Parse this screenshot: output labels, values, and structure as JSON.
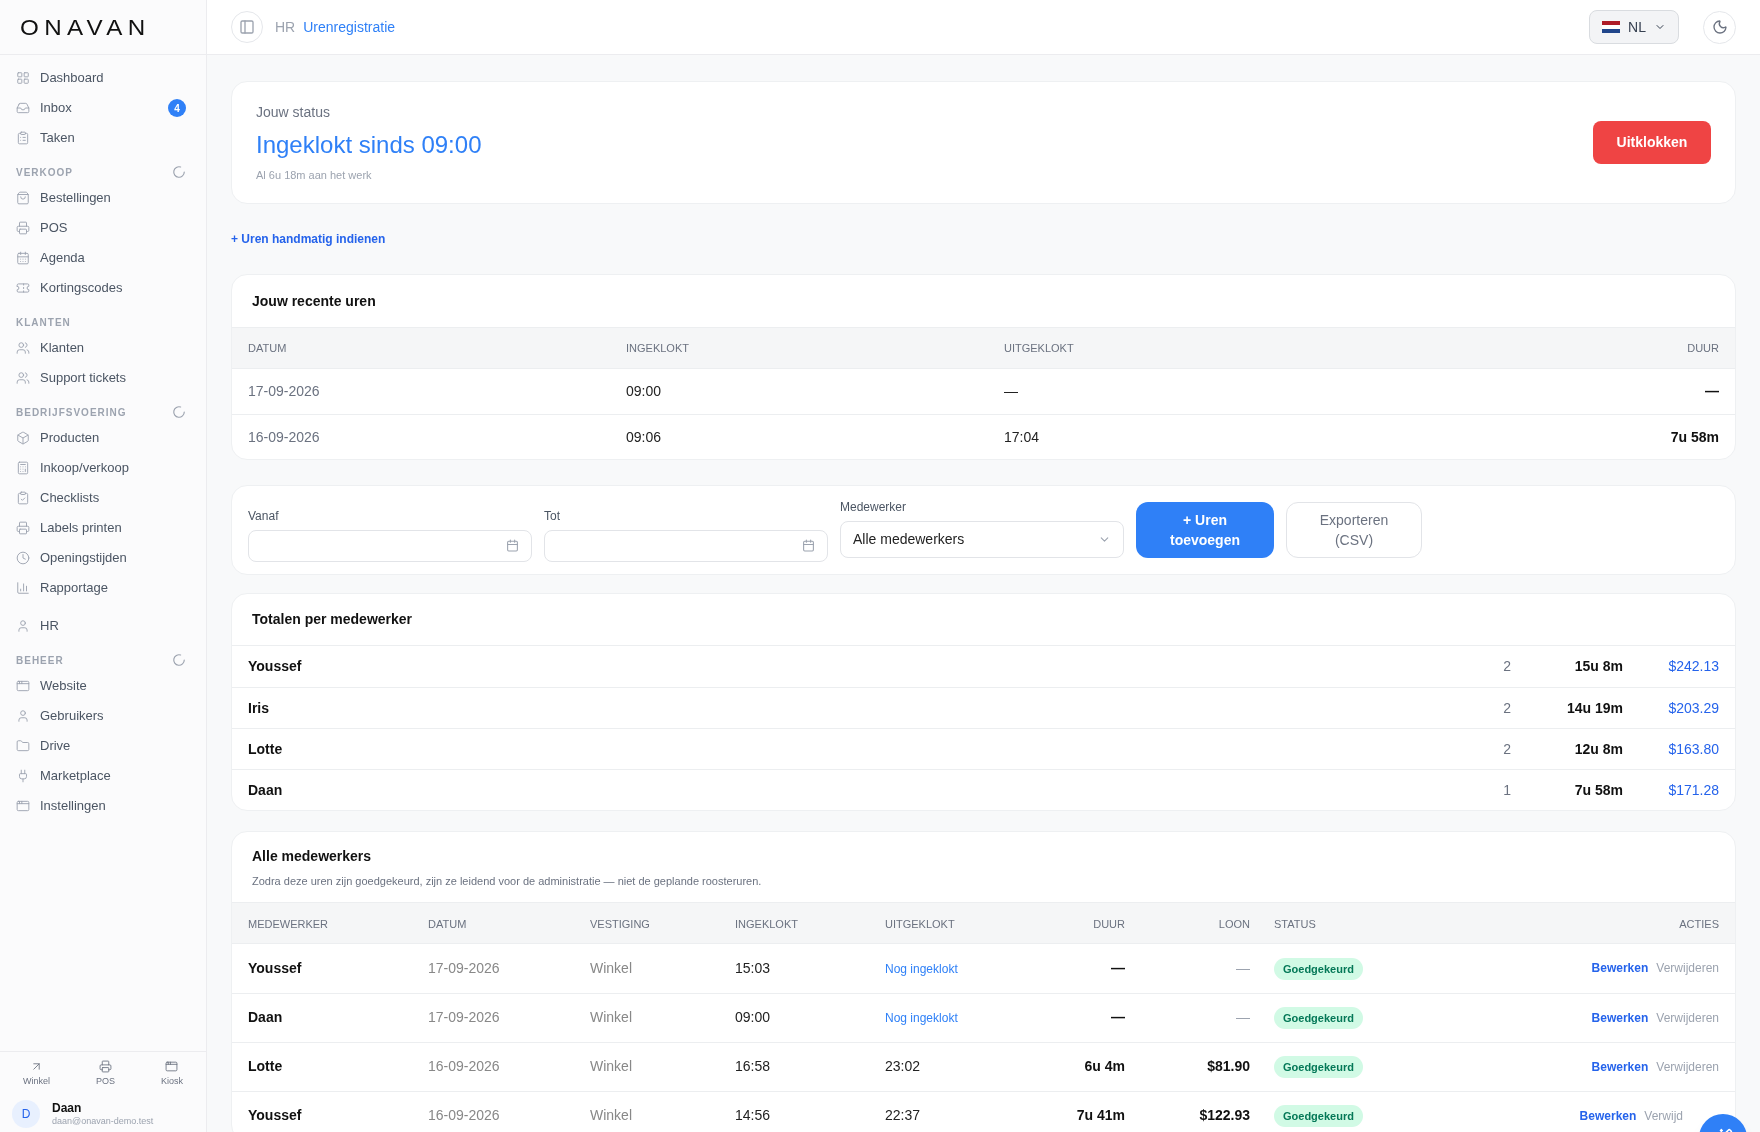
{
  "sidebar": {
    "logo": "ONAVAN",
    "sections": [
      {
        "items": [
          {
            "label": "Dashboard"
          },
          {
            "label": "Inbox",
            "badge": "4"
          },
          {
            "label": "Taken"
          }
        ]
      },
      {
        "title": "VERKOOP",
        "loading": true,
        "items": [
          {
            "label": "Bestellingen"
          },
          {
            "label": "POS"
          },
          {
            "label": "Agenda"
          },
          {
            "label": "Kortingscodes"
          }
        ]
      },
      {
        "title": "KLANTEN",
        "loading": false,
        "items": [
          {
            "label": "Klanten"
          },
          {
            "label": "Support tickets"
          }
        ]
      },
      {
        "title": "BEDRIJFSVOERING",
        "loading": true,
        "items": [
          {
            "label": "Producten"
          },
          {
            "label": "Inkoop/verkoop"
          },
          {
            "label": "Checklists"
          },
          {
            "label": "Labels printen"
          },
          {
            "label": "Openingstijden"
          },
          {
            "label": "Rapportage"
          }
        ]
      },
      {
        "items": [
          {
            "label": "HR"
          }
        ]
      },
      {
        "title": "BEHEER",
        "loading": true,
        "items": [
          {
            "label": "Website"
          },
          {
            "label": "Gebruikers"
          },
          {
            "label": "Drive"
          },
          {
            "label": "Marketplace"
          },
          {
            "label": "Instellingen"
          }
        ]
      }
    ],
    "quick_links": [
      "Winkel",
      "POS",
      "Kiosk"
    ],
    "user": {
      "initial": "D",
      "name": "Daan",
      "email": "daan@onavan-demo.test"
    }
  },
  "header": {
    "breadcrumb": [
      "HR",
      "Urenregistratie"
    ],
    "language": "NL"
  },
  "status": {
    "label": "Jouw status",
    "title": "Ingeklokt sinds 09:00",
    "subtitle": "Al 6u 18m aan het werk",
    "button": "Uitklokken"
  },
  "manual_link": "+ Uren handmatig indienen",
  "recent": {
    "title": "Jouw recente uren",
    "columns": [
      "DATUM",
      "INGEKLOKT",
      "UITGEKLOKT",
      "DUUR"
    ],
    "rows": [
      [
        "17-09-2026",
        "09:00",
        "—",
        "—"
      ],
      [
        "16-09-2026",
        "09:06",
        "17:04",
        "7u 58m"
      ]
    ]
  },
  "filters": {
    "from_label": "Vanaf",
    "to_label": "Tot",
    "employee_label": "Medewerker",
    "employee_value": "Alle medewerkers",
    "add_button": "+ Uren toevoegen",
    "export_button": "Exporteren (CSV)"
  },
  "totals": {
    "title": "Totalen per medewerker",
    "rows": [
      {
        "name": "Youssef",
        "count": "2",
        "duration": "15u 8m",
        "amount": "$242.13"
      },
      {
        "name": "Iris",
        "count": "2",
        "duration": "14u 19m",
        "amount": "$203.29"
      },
      {
        "name": "Lotte",
        "count": "2",
        "duration": "12u 8m",
        "amount": "$163.80"
      },
      {
        "name": "Daan",
        "count": "1",
        "duration": "7u 58m",
        "amount": "$171.28"
      }
    ]
  },
  "all": {
    "title": "Alle medewerkers",
    "description": "Zodra deze uren zijn goedgekeurd, zijn ze leidend voor de administratie — niet de geplande roosteruren.",
    "columns": [
      "MEDEWERKER",
      "DATUM",
      "VESTIGING",
      "INGEKLOKT",
      "UITGEKLOKT",
      "DUUR",
      "LOON",
      "STATUS",
      "ACTIES"
    ],
    "rows": [
      {
        "employee": "Youssef",
        "date": "17-09-2026",
        "location": "Winkel",
        "in": "15:03",
        "out": "Nog ingeklokt",
        "clocked_in": true,
        "duration": "—",
        "wage": "—",
        "status": "Goedgekeurd",
        "edit": "Bewerken",
        "delete": "Verwijderen"
      },
      {
        "employee": "Daan",
        "date": "17-09-2026",
        "location": "Winkel",
        "in": "09:00",
        "out": "Nog ingeklokt",
        "clocked_in": true,
        "duration": "—",
        "wage": "—",
        "status": "Goedgekeurd",
        "edit": "Bewerken",
        "delete": "Verwijderen"
      },
      {
        "employee": "Lotte",
        "date": "16-09-2026",
        "location": "Winkel",
        "in": "16:58",
        "out": "23:02",
        "clocked_in": false,
        "duration": "6u 4m",
        "wage": "$81.90",
        "status": "Goedgekeurd",
        "edit": "Bewerken",
        "delete": "Verwijderen"
      },
      {
        "employee": "Youssef",
        "date": "16-09-2026",
        "location": "Winkel",
        "in": "14:56",
        "out": "22:37",
        "clocked_in": false,
        "duration": "7u 41m",
        "wage": "$122.93",
        "status": "Goedgekeurd",
        "edit": "Bewerken",
        "delete": "Verwijd"
      }
    ]
  }
}
